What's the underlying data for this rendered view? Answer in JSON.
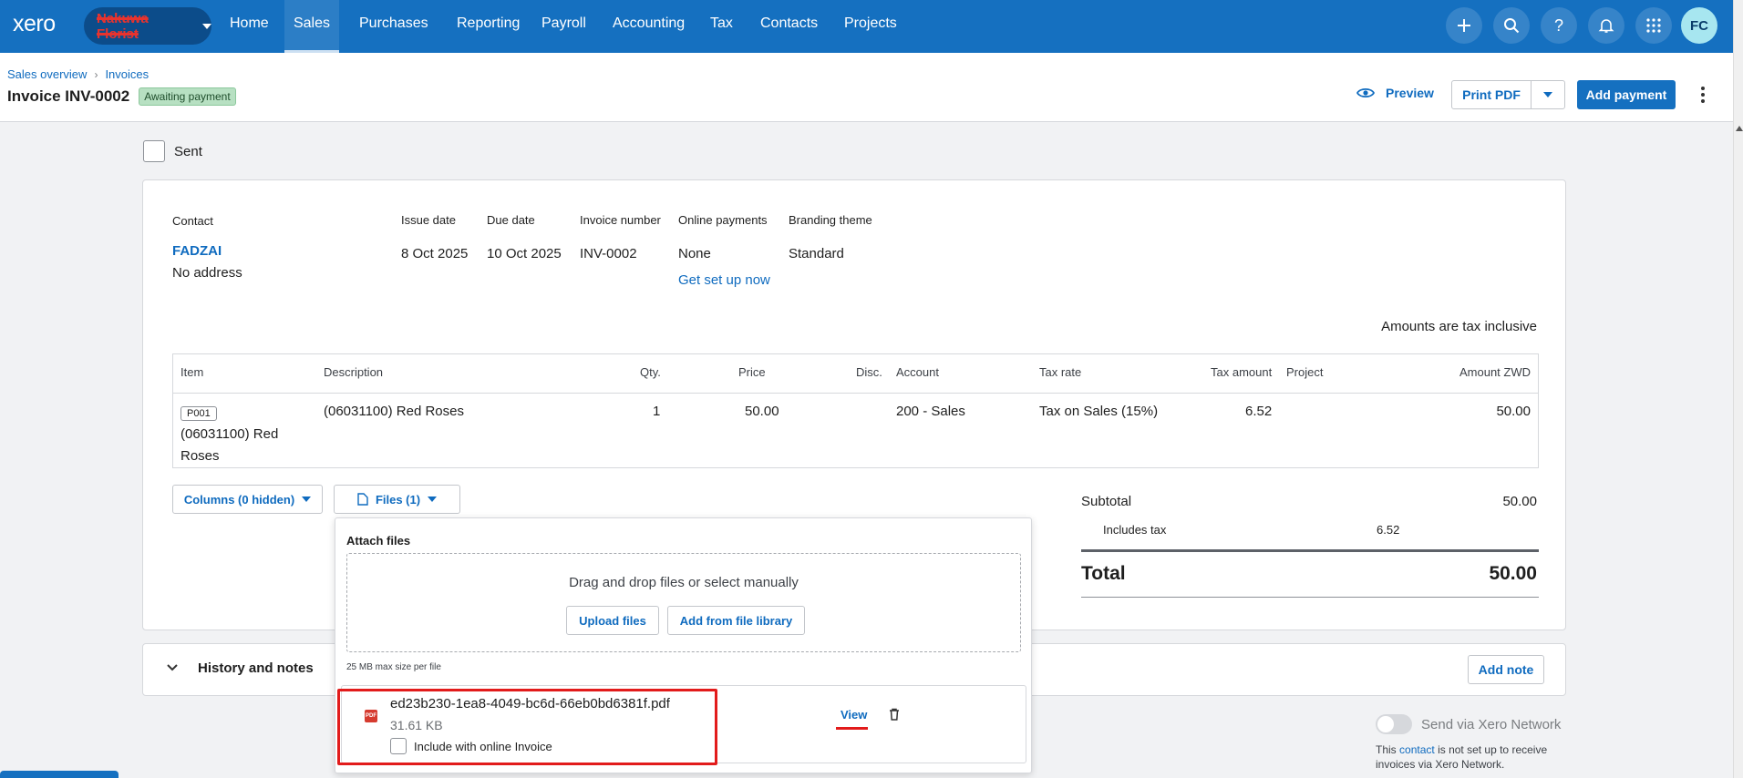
{
  "nav": {
    "logo": "xero",
    "org_name": "Nakuwa Florist",
    "items": [
      "Home",
      "Sales",
      "Purchases",
      "Reporting",
      "Payroll",
      "Accounting",
      "Tax",
      "Contacts",
      "Projects"
    ],
    "active": "Sales",
    "avatar_initials": "FC"
  },
  "breadcrumb": {
    "first": "Sales overview",
    "second": "Invoices"
  },
  "invoice": {
    "title": "Invoice INV-0002",
    "status": "Awaiting payment",
    "sent_label": "Sent",
    "contact_label": "Contact",
    "contact_name": "FADZAI",
    "contact_address": "No address",
    "issue_date_label": "Issue date",
    "issue_date": "8 Oct 2025",
    "due_date_label": "Due date",
    "due_date": "10 Oct 2025",
    "number_label": "Invoice number",
    "number": "INV-0002",
    "online_payments_label": "Online payments",
    "online_payments": "None",
    "online_payments_link": "Get set up now",
    "branding_label": "Branding theme",
    "branding": "Standard",
    "tax_note": "Amounts are tax inclusive"
  },
  "actions": {
    "preview": "Preview",
    "print_pdf": "Print PDF",
    "add_payment": "Add payment"
  },
  "table": {
    "headers": {
      "item": "Item",
      "description": "Description",
      "qty": "Qty.",
      "price": "Price",
      "disc": "Disc.",
      "account": "Account",
      "tax_rate": "Tax rate",
      "tax_amount": "Tax amount",
      "project": "Project",
      "amount": "Amount ZWD"
    },
    "rows": [
      {
        "code": "P001",
        "item": "(06031100) Red Roses",
        "description": "(06031100) Red Roses",
        "qty": "1",
        "price": "50.00",
        "disc": "",
        "account": "200 - Sales",
        "tax_rate": "Tax on Sales (15%)",
        "tax_amount": "6.52",
        "project": "",
        "amount": "50.00"
      }
    ]
  },
  "controls": {
    "columns": "Columns (0 hidden)",
    "files": "Files (1)"
  },
  "totals": {
    "subtotal_label": "Subtotal",
    "subtotal": "50.00",
    "includes_tax_label": "Includes tax",
    "includes_tax": "6.52",
    "total_label": "Total",
    "total": "50.00"
  },
  "files_popup": {
    "title": "Attach files",
    "drop_text": "Drag and drop files or select manually",
    "upload": "Upload files",
    "library": "Add from file library",
    "max_size": "25 MB max size per file",
    "file_badge": "PDF",
    "file_name": "ed23b230-1ea8-4049-bc6d-66eb0bd6381f.pdf",
    "file_size": "31.61 KB",
    "include_label": "Include with online Invoice",
    "view": "View"
  },
  "history": {
    "title": "History and notes",
    "add_note": "Add note"
  },
  "network": {
    "toggle_label": "Send via Xero Network",
    "msg_before": "This",
    "msg_link": "contact",
    "msg_after": "is not set up to receive invoices via Xero Network."
  },
  "colors": {
    "nav": "#1570c0",
    "link": "#0f6bbf",
    "highlight": "#e21b1b",
    "status_bg": "#b7e0c2"
  }
}
